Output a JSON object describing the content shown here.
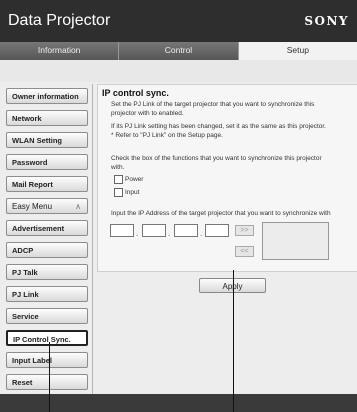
{
  "app": {
    "title": "Data Projector",
    "brand": "SONY"
  },
  "tabs": [
    {
      "label": "Information"
    },
    {
      "label": "Control"
    },
    {
      "label": "Setup"
    }
  ],
  "sidebar": {
    "items": [
      {
        "label": "Owner information"
      },
      {
        "label": "Network"
      },
      {
        "label": "WLAN Setting"
      },
      {
        "label": "Password"
      },
      {
        "label": "Mail Report"
      },
      {
        "label": "Easy Menu"
      },
      {
        "label": "Advertisement"
      },
      {
        "label": "ADCP"
      },
      {
        "label": "PJ Talk"
      },
      {
        "label": "PJ Link"
      },
      {
        "label": "Service"
      },
      {
        "label": "IP Control Sync."
      },
      {
        "label": "Input Label"
      },
      {
        "label": "Reset"
      }
    ],
    "active_index": 11
  },
  "panel": {
    "title": "IP control sync.",
    "desc1": "Set the PJ Link of the target projector that you want to synchronize this",
    "desc2": "projector with to enabled.",
    "desc3": "If its PJ Link setting has been changed, set it as the same as this projector.",
    "desc4": "* Refer to \"PJ Link\" on the Setup page.",
    "check_intro1": "Check the box of the functions that you want to synchronize this projector",
    "check_intro2": "with.",
    "power_label": "Power",
    "input_label": "Input",
    "ip_intro": "Input the IP Address of the target projector that you want to synchronize with",
    "add_button": ">>",
    "remove_button": "<<"
  },
  "apply_button": "Apply"
}
